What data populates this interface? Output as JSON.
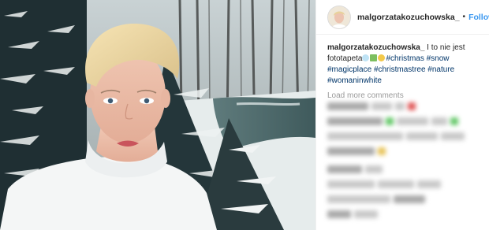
{
  "post": {
    "username": "malgorzatakozuchowska_",
    "separator": "•",
    "follow_label": "Follow"
  },
  "caption": {
    "username": "malgorzatakozuchowska_",
    "text": "I to nie jest fototapeta",
    "hashtags": [
      "#christmas",
      "#snow",
      "#magicplace",
      "#christmastree",
      "#nature",
      "#womaninwhite"
    ]
  },
  "comments": {
    "load_more_label": "Load more comments"
  },
  "colors": {
    "link_blue": "#3897f0",
    "hashtag": "#003569",
    "muted": "#999999"
  }
}
